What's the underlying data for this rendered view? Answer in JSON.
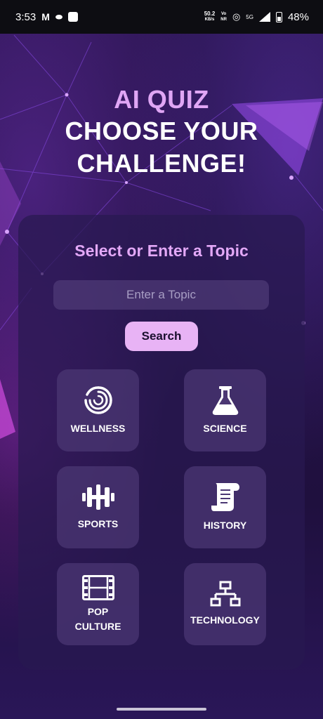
{
  "status_bar": {
    "time": "3:53",
    "speed_value": "50.2",
    "speed_unit": "KB/s",
    "volte_line1": "Vo",
    "volte_line2": "NR",
    "network": "5G",
    "battery": "48%"
  },
  "header": {
    "line1": "AI QUIZ",
    "line2": "CHOOSE YOUR",
    "line3": "CHALLENGE!"
  },
  "topic_card": {
    "heading": "Select or Enter a Topic",
    "input_placeholder": "Enter a Topic",
    "input_value": "",
    "search_label": "Search"
  },
  "topics": [
    {
      "label": "WELLNESS",
      "icon": "wellness-swirl-icon"
    },
    {
      "label": "SCIENCE",
      "icon": "flask-icon"
    },
    {
      "label": "SPORTS",
      "icon": "dumbbell-icon"
    },
    {
      "label": "HISTORY",
      "icon": "scroll-icon"
    },
    {
      "label_line1": "POP",
      "label_line2": "CULTURE",
      "icon": "film-icon"
    },
    {
      "label": "TECHNOLOGY",
      "icon": "network-icon"
    }
  ],
  "colors": {
    "accent_pink": "#e3a8f7",
    "button": "#e8b3f5",
    "card": "#281950",
    "tile": "#4b3773"
  }
}
